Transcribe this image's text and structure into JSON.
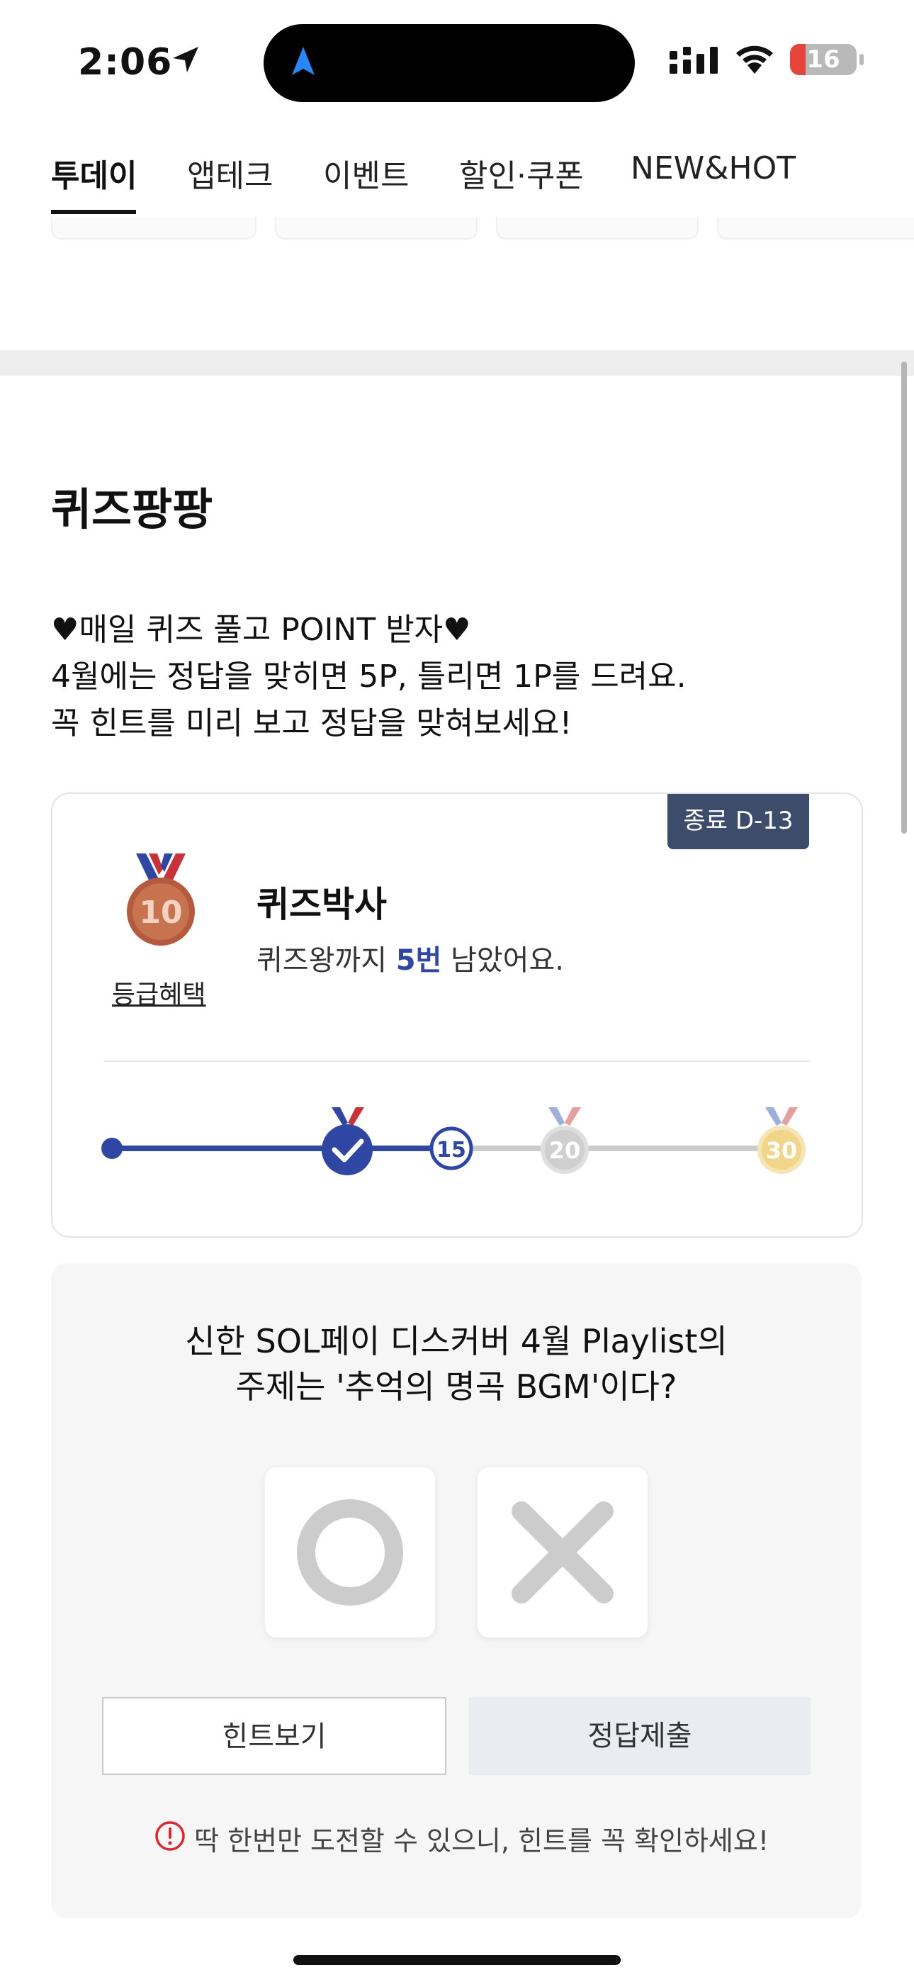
{
  "status_bar": {
    "time": "2:06",
    "battery": "16"
  },
  "tabs": [
    {
      "label": "투데이",
      "active": true
    },
    {
      "label": "앱테크",
      "active": false
    },
    {
      "label": "이벤트",
      "active": false
    },
    {
      "label": "할인·쿠폰",
      "active": false
    },
    {
      "label": "NEW&HOT",
      "active": false
    }
  ],
  "section": {
    "title": "퀴즈팡팡",
    "description": [
      "♥매일 퀴즈 풀고 POINT 받자♥",
      "4월에는 정답을 맞히면 5P, 틀리면 1P를 드려요.",
      "꼭 힌트를 미리 보고 정답을 맞혀보세요!"
    ]
  },
  "rank_card": {
    "dday": "종료 D-13",
    "medal_number": "10",
    "grade_benefit_link": "등급혜택",
    "rank_name": "퀴즈박사",
    "remaining_prefix": "퀴즈왕까지 ",
    "remaining_count": "5번",
    "remaining_suffix": " 남았어요.",
    "progress": {
      "current_marker": "15",
      "milestones": [
        "10",
        "20",
        "30"
      ],
      "current_value": 15,
      "max_value": 30
    }
  },
  "quiz": {
    "question_lines": [
      "신한 SOL페이 디스커버 4월 Playlist의",
      "주제는 '추억의 명곡 BGM'이다?"
    ],
    "hint_button": "힌트보기",
    "submit_button": "정답제출",
    "warning": "딱 한번만 도전할 수 있으니, 힌트를 꼭 확인하세요!"
  },
  "colors": {
    "accent": "#2f47a2",
    "dday_bg": "#3d4c6b",
    "warning": "#d9282f",
    "bronze": "#c0674a",
    "silver": "#cfcfcf",
    "gold": "#f0d58a"
  }
}
